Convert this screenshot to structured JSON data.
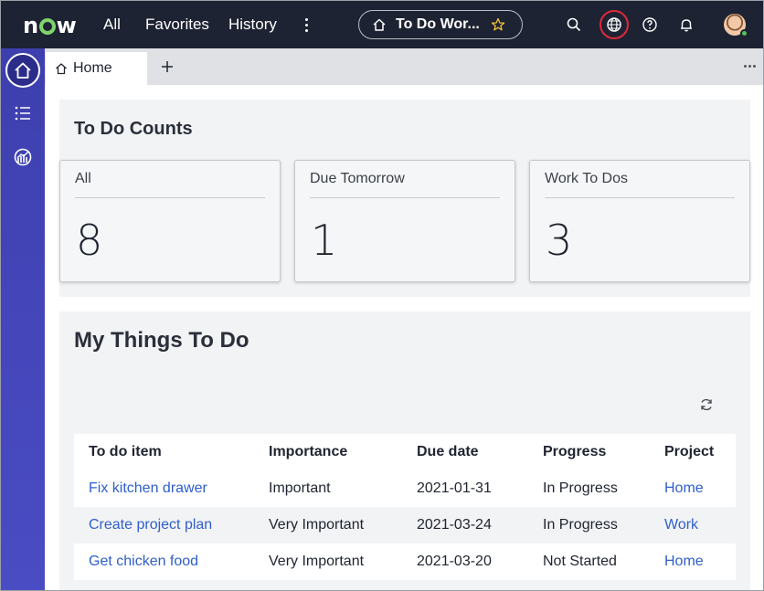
{
  "topnav": {
    "logo": "now",
    "links": [
      "All",
      "Favorites",
      "History"
    ],
    "app_title": "To Do Wor...",
    "icons": [
      "search-icon",
      "globe-icon",
      "help-icon",
      "bell-icon"
    ],
    "status_color": "#52c05a",
    "highlight_color": "#e0283c"
  },
  "sidebar": {
    "items": [
      "home-icon",
      "list-icon",
      "analytics-icon"
    ],
    "active": "home-icon"
  },
  "tabs": {
    "items": [
      {
        "label": "Home"
      }
    ]
  },
  "counts_panel": {
    "title": "To Do Counts",
    "cards": [
      {
        "label": "All",
        "value": "8"
      },
      {
        "label": "Due Tomorrow",
        "value": "1"
      },
      {
        "label": "Work To Dos",
        "value": "3"
      }
    ]
  },
  "todo_panel": {
    "title": "My Things To Do",
    "columns": [
      "To do item",
      "Importance",
      "Due date",
      "Progress",
      "Project"
    ],
    "rows": [
      {
        "item": "Fix kitchen drawer",
        "importance": "Important",
        "due": "2021-01-31",
        "progress": "In Progress",
        "project": "Home"
      },
      {
        "item": "Create project plan",
        "importance": "Very Important",
        "due": "2021-03-24",
        "progress": "In Progress",
        "project": "Work"
      },
      {
        "item": "Get chicken food",
        "importance": "Very Important",
        "due": "2021-03-20",
        "progress": "Not Started",
        "project": "Home"
      }
    ],
    "link_color": "#2f5fc9"
  }
}
